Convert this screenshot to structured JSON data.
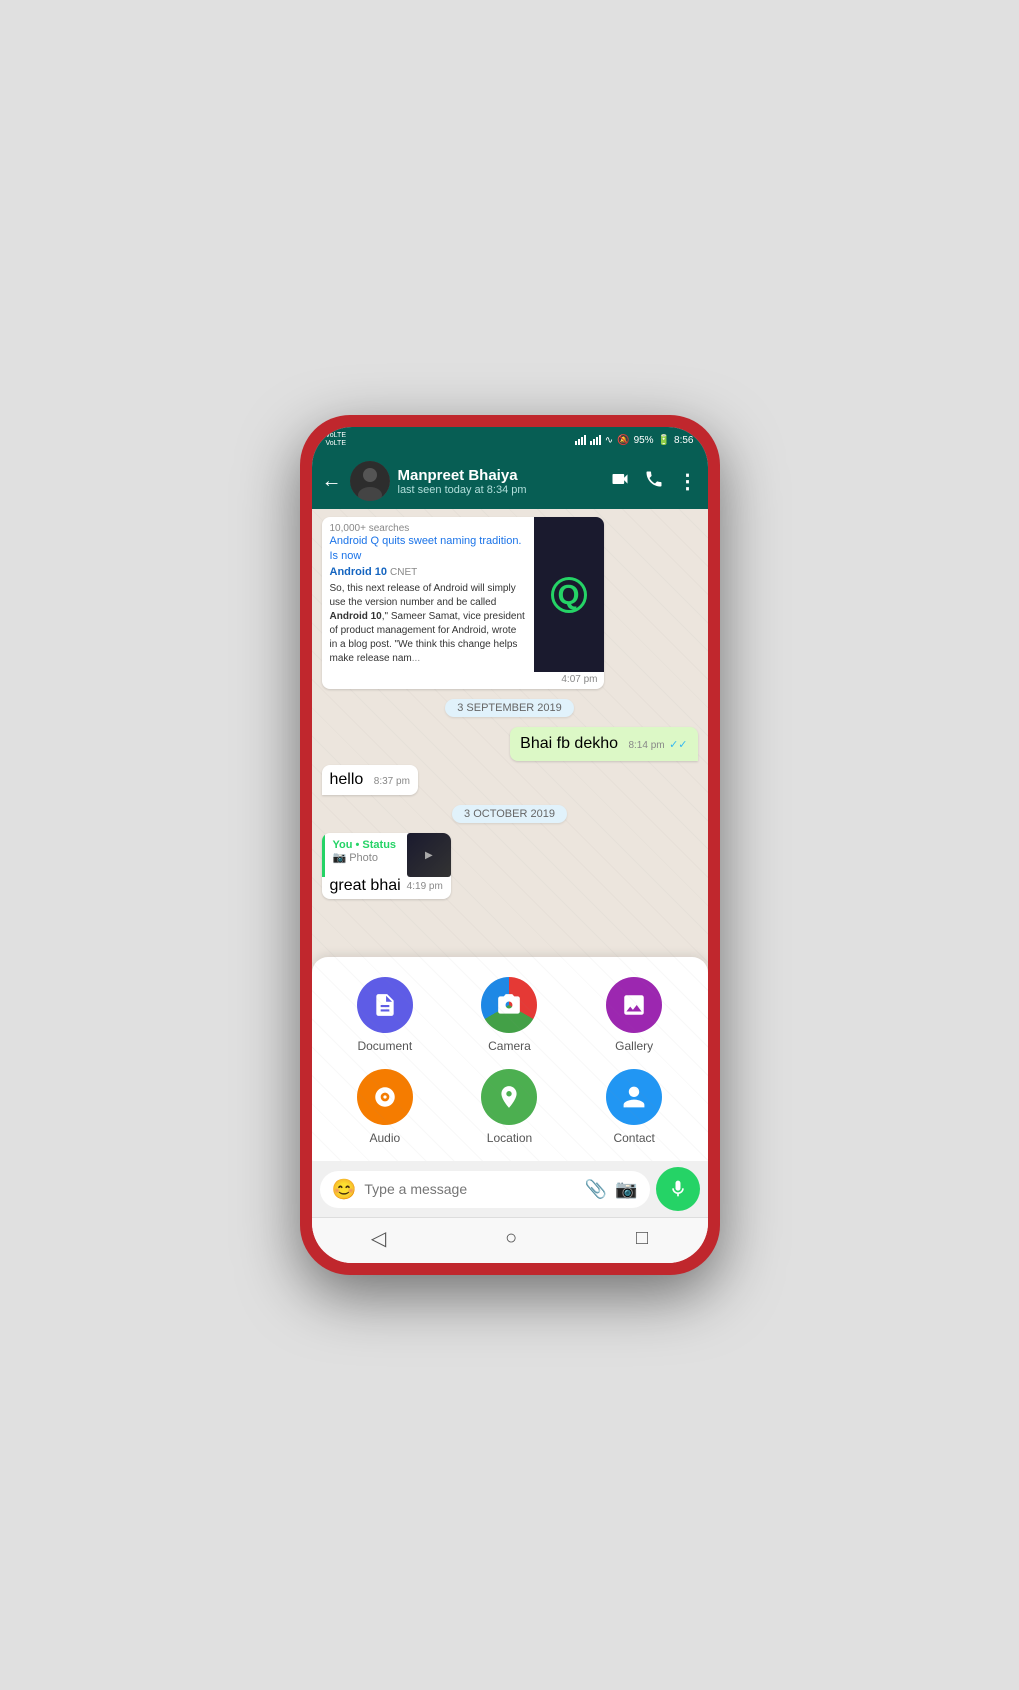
{
  "statusBar": {
    "network1": "VoLTE",
    "network2": "VoLTE",
    "battery": "95%",
    "time": "8:56"
  },
  "header": {
    "contactName": "Manpreet Bhaiya",
    "lastSeen": "last seen today at 8:34 pm",
    "backLabel": "←",
    "videoCallIcon": "📹",
    "callIcon": "📞",
    "moreIcon": "⋮"
  },
  "messages": [
    {
      "type": "link",
      "searches": "10,000+ searches",
      "title1": "Android Q quits sweet naming tradition. Is now",
      "title2": "Android 10",
      "source": "CNET",
      "description": "So, this next release of Android will simply use the version number and be called Android 10,\" Sameer Samat, vice president of product management for Android, wrote in a blog post. \"We think this change helps make release names simpler and more intuitive.",
      "time": "4:07 pm"
    },
    {
      "type": "dateDivider",
      "text": "3 SEPTEMBER 2019"
    },
    {
      "type": "sent",
      "text": "Bhai fb dekho",
      "time": "8:14 pm",
      "checks": "✓✓"
    },
    {
      "type": "received",
      "text": "hello",
      "time": "8:37 pm"
    },
    {
      "type": "dateDivider",
      "text": "3 OCTOBER 2019"
    },
    {
      "type": "statusShare",
      "statusFrom": "You • Status",
      "photoLabel": "Photo",
      "message": "great bhai",
      "time": "4:19 pm"
    }
  ],
  "attachPanel": {
    "items": [
      {
        "id": "document",
        "label": "Document",
        "icon": "📄",
        "colorClass": "icon-document"
      },
      {
        "id": "camera",
        "label": "Camera",
        "icon": "📷",
        "colorClass": "icon-camera"
      },
      {
        "id": "gallery",
        "label": "Gallery",
        "icon": "🖼",
        "colorClass": "icon-gallery"
      },
      {
        "id": "audio",
        "label": "Audio",
        "icon": "🎧",
        "colorClass": "icon-audio"
      },
      {
        "id": "location",
        "label": "Location",
        "icon": "📍",
        "colorClass": "icon-location"
      },
      {
        "id": "contact",
        "label": "Contact",
        "icon": "👤",
        "colorClass": "icon-contact"
      }
    ]
  },
  "inputBar": {
    "placeholder": "Type a message",
    "emojiIcon": "😊",
    "attachIcon": "📎",
    "cameraIcon": "📷",
    "micIcon": "🎤"
  },
  "navBar": {
    "back": "◁",
    "home": "○",
    "recent": "□"
  }
}
